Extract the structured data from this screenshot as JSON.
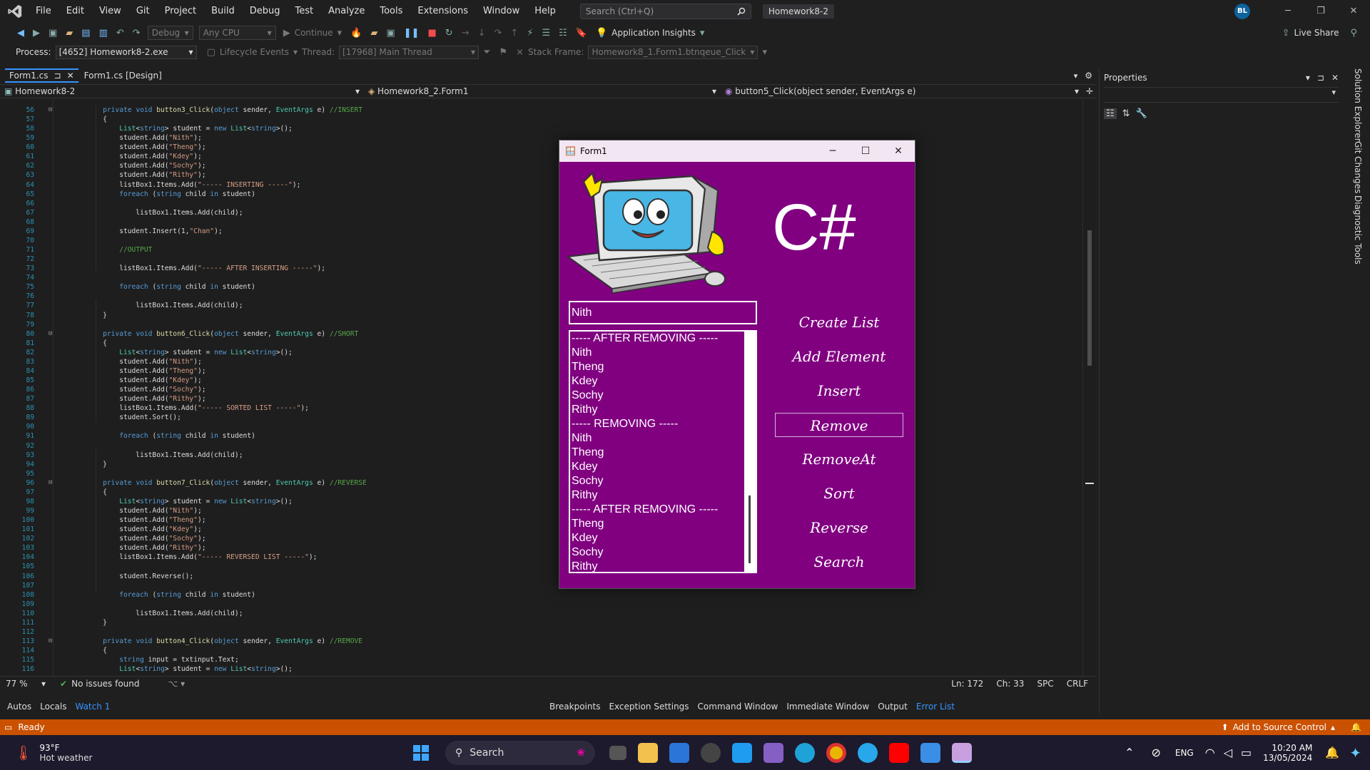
{
  "menubar": {
    "items": [
      "File",
      "Edit",
      "View",
      "Git",
      "Project",
      "Build",
      "Debug",
      "Test",
      "Analyze",
      "Tools",
      "Extensions",
      "Window",
      "Help"
    ],
    "search_placeholder": "Search (Ctrl+Q)",
    "solution_name": "Homework8-2",
    "avatar_initials": "BL"
  },
  "toolbar": {
    "config": "Debug",
    "platform": "Any CPU",
    "continue_label": "Continue",
    "app_insights": "Application Insights",
    "live_share": "Live Share"
  },
  "processbar": {
    "process_label": "Process:",
    "process_value": "[4652] Homework8-2.exe",
    "lifecycle_label": "Lifecycle Events",
    "thread_label": "Thread:",
    "thread_value": "[17968] Main Thread",
    "stackframe_label": "Stack Frame:",
    "stackframe_value": "Homework8_1.Form1.btnqeue_Click"
  },
  "tabs": [
    {
      "label": "Form1.cs",
      "pin": "⊐",
      "close": "✕"
    },
    {
      "label": "Form1.cs [Design]"
    }
  ],
  "navbar": {
    "project": "Homework8-2",
    "class": "Homework8_2.Form1",
    "member": "button5_Click(object sender, EventArgs e)"
  },
  "code_lines": [
    {
      "n": "56",
      "t": [
        [
          "    ",
          ""
        ],
        [
          "private void ",
          "kw"
        ],
        [
          "button3_Click",
          "fn"
        ],
        [
          "(",
          ""
        ],
        [
          "object ",
          "kw"
        ],
        [
          "sender, ",
          ""
        ],
        [
          "EventArgs ",
          "ty"
        ],
        [
          "e) ",
          ""
        ],
        [
          "//INSERT",
          "cm"
        ]
      ]
    },
    {
      "n": "57",
      "t": [
        [
          "    {",
          ""
        ]
      ]
    },
    {
      "n": "58",
      "t": [
        [
          "        ",
          ""
        ],
        [
          "List",
          "ty"
        ],
        [
          "<",
          ""
        ],
        [
          "string",
          "kw"
        ],
        [
          "> student = ",
          ""
        ],
        [
          "new ",
          "kw"
        ],
        [
          "List",
          "ty"
        ],
        [
          "<",
          ""
        ],
        [
          "string",
          "kw"
        ],
        [
          ">();",
          ""
        ]
      ]
    },
    {
      "n": "59",
      "t": [
        [
          "        student.Add(",
          ""
        ],
        [
          "\"Nith\"",
          "st"
        ],
        [
          ");",
          ""
        ]
      ]
    },
    {
      "n": "60",
      "t": [
        [
          "        student.Add(",
          ""
        ],
        [
          "\"Theng\"",
          "st"
        ],
        [
          ");",
          ""
        ]
      ]
    },
    {
      "n": "61",
      "t": [
        [
          "        student.Add(",
          ""
        ],
        [
          "\"Kdey\"",
          "st"
        ],
        [
          ");",
          ""
        ]
      ]
    },
    {
      "n": "62",
      "t": [
        [
          "        student.Add(",
          ""
        ],
        [
          "\"Sochy\"",
          "st"
        ],
        [
          ");",
          ""
        ]
      ]
    },
    {
      "n": "63",
      "t": [
        [
          "        student.Add(",
          ""
        ],
        [
          "\"Rithy\"",
          "st"
        ],
        [
          ");",
          ""
        ]
      ]
    },
    {
      "n": "64",
      "t": [
        [
          "        listBox1.Items.Add(",
          ""
        ],
        [
          "\"----- INSERTING -----\"",
          "st"
        ],
        [
          ");",
          ""
        ]
      ]
    },
    {
      "n": "65",
      "t": [
        [
          "        ",
          ""
        ],
        [
          "foreach ",
          "kw"
        ],
        [
          "(",
          ""
        ],
        [
          "string ",
          "kw"
        ],
        [
          "child ",
          ""
        ],
        [
          "in ",
          "kw"
        ],
        [
          "student)",
          ""
        ]
      ]
    },
    {
      "n": "66",
      "t": [
        [
          "",
          ""
        ]
      ]
    },
    {
      "n": "67",
      "t": [
        [
          "            listBox1.Items.Add(child);",
          ""
        ]
      ]
    },
    {
      "n": "68",
      "t": [
        [
          "",
          ""
        ]
      ]
    },
    {
      "n": "69",
      "t": [
        [
          "        student.Insert(1,",
          ""
        ],
        [
          "\"Chan\"",
          "st"
        ],
        [
          ");",
          ""
        ]
      ]
    },
    {
      "n": "70",
      "t": [
        [
          "",
          ""
        ]
      ]
    },
    {
      "n": "71",
      "t": [
        [
          "        ",
          ""
        ],
        [
          "//OUTPUT",
          "cm"
        ]
      ]
    },
    {
      "n": "72",
      "t": [
        [
          "",
          ""
        ]
      ]
    },
    {
      "n": "73",
      "t": [
        [
          "        listBox1.Items.Add(",
          ""
        ],
        [
          "\"----- AFTER INSERTING -----\"",
          "st"
        ],
        [
          ");",
          ""
        ]
      ]
    },
    {
      "n": "74",
      "t": [
        [
          "",
          ""
        ]
      ]
    },
    {
      "n": "75",
      "t": [
        [
          "        ",
          ""
        ],
        [
          "foreach ",
          "kw"
        ],
        [
          "(",
          ""
        ],
        [
          "string ",
          "kw"
        ],
        [
          "child ",
          ""
        ],
        [
          "in ",
          "kw"
        ],
        [
          "student)",
          ""
        ]
      ]
    },
    {
      "n": "76",
      "t": [
        [
          "",
          ""
        ]
      ]
    },
    {
      "n": "77",
      "t": [
        [
          "            listBox1.Items.Add(child);",
          ""
        ]
      ]
    },
    {
      "n": "78",
      "t": [
        [
          "    }",
          ""
        ]
      ]
    },
    {
      "n": "79",
      "t": [
        [
          "",
          ""
        ]
      ]
    },
    {
      "n": "80",
      "t": [
        [
          "    ",
          ""
        ],
        [
          "private void ",
          "kw"
        ],
        [
          "button6_Click",
          "fn"
        ],
        [
          "(",
          ""
        ],
        [
          "object ",
          "kw"
        ],
        [
          "sender, ",
          ""
        ],
        [
          "EventArgs ",
          "ty"
        ],
        [
          "e) ",
          ""
        ],
        [
          "//SHORT",
          "cm"
        ]
      ]
    },
    {
      "n": "81",
      "t": [
        [
          "    {",
          ""
        ]
      ]
    },
    {
      "n": "82",
      "t": [
        [
          "        ",
          ""
        ],
        [
          "List",
          "ty"
        ],
        [
          "<",
          ""
        ],
        [
          "string",
          "kw"
        ],
        [
          "> student = ",
          ""
        ],
        [
          "new ",
          "kw"
        ],
        [
          "List",
          "ty"
        ],
        [
          "<",
          ""
        ],
        [
          "string",
          "kw"
        ],
        [
          ">();",
          ""
        ]
      ]
    },
    {
      "n": "83",
      "t": [
        [
          "        student.Add(",
          ""
        ],
        [
          "\"Nith\"",
          "st"
        ],
        [
          ");",
          ""
        ]
      ]
    },
    {
      "n": "84",
      "t": [
        [
          "        student.Add(",
          ""
        ],
        [
          "\"Theng\"",
          "st"
        ],
        [
          ");",
          ""
        ]
      ]
    },
    {
      "n": "85",
      "t": [
        [
          "        student.Add(",
          ""
        ],
        [
          "\"Kdey\"",
          "st"
        ],
        [
          ");",
          ""
        ]
      ]
    },
    {
      "n": "86",
      "t": [
        [
          "        student.Add(",
          ""
        ],
        [
          "\"Sochy\"",
          "st"
        ],
        [
          ");",
          ""
        ]
      ]
    },
    {
      "n": "87",
      "t": [
        [
          "        student.Add(",
          ""
        ],
        [
          "\"Rithy\"",
          "st"
        ],
        [
          ");",
          ""
        ]
      ]
    },
    {
      "n": "88",
      "t": [
        [
          "        listBox1.Items.Add(",
          ""
        ],
        [
          "\"----- SORTED LIST -----\"",
          "st"
        ],
        [
          ");",
          ""
        ]
      ]
    },
    {
      "n": "89",
      "t": [
        [
          "        student.Sort();",
          ""
        ]
      ]
    },
    {
      "n": "90",
      "t": [
        [
          "",
          ""
        ]
      ]
    },
    {
      "n": "91",
      "t": [
        [
          "        ",
          ""
        ],
        [
          "foreach ",
          "kw"
        ],
        [
          "(",
          ""
        ],
        [
          "string ",
          "kw"
        ],
        [
          "child ",
          ""
        ],
        [
          "in ",
          "kw"
        ],
        [
          "student)",
          ""
        ]
      ]
    },
    {
      "n": "92",
      "t": [
        [
          "",
          ""
        ]
      ]
    },
    {
      "n": "93",
      "t": [
        [
          "            listBox1.Items.Add(child);",
          ""
        ]
      ]
    },
    {
      "n": "94",
      "t": [
        [
          "    }",
          ""
        ]
      ]
    },
    {
      "n": "95",
      "t": [
        [
          "",
          ""
        ]
      ]
    },
    {
      "n": "96",
      "t": [
        [
          "    ",
          ""
        ],
        [
          "private void ",
          "kw"
        ],
        [
          "button7_Click",
          "fn"
        ],
        [
          "(",
          ""
        ],
        [
          "object ",
          "kw"
        ],
        [
          "sender, ",
          ""
        ],
        [
          "EventArgs ",
          "ty"
        ],
        [
          "e) ",
          ""
        ],
        [
          "//REVERSE",
          "cm"
        ]
      ]
    },
    {
      "n": "97",
      "t": [
        [
          "    {",
          ""
        ]
      ]
    },
    {
      "n": "98",
      "t": [
        [
          "        ",
          ""
        ],
        [
          "List",
          "ty"
        ],
        [
          "<",
          ""
        ],
        [
          "string",
          "kw"
        ],
        [
          "> student = ",
          ""
        ],
        [
          "new ",
          "kw"
        ],
        [
          "List",
          "ty"
        ],
        [
          "<",
          ""
        ],
        [
          "string",
          "kw"
        ],
        [
          ">();",
          ""
        ]
      ]
    },
    {
      "n": "99",
      "t": [
        [
          "        student.Add(",
          ""
        ],
        [
          "\"Nith\"",
          "st"
        ],
        [
          ");",
          ""
        ]
      ]
    },
    {
      "n": "100",
      "t": [
        [
          "        student.Add(",
          ""
        ],
        [
          "\"Theng\"",
          "st"
        ],
        [
          ");",
          ""
        ]
      ]
    },
    {
      "n": "101",
      "t": [
        [
          "        student.Add(",
          ""
        ],
        [
          "\"Kdey\"",
          "st"
        ],
        [
          ");",
          ""
        ]
      ]
    },
    {
      "n": "102",
      "t": [
        [
          "        student.Add(",
          ""
        ],
        [
          "\"Sochy\"",
          "st"
        ],
        [
          ");",
          ""
        ]
      ]
    },
    {
      "n": "103",
      "t": [
        [
          "        student.Add(",
          ""
        ],
        [
          "\"Rithy\"",
          "st"
        ],
        [
          ");",
          ""
        ]
      ]
    },
    {
      "n": "104",
      "t": [
        [
          "        listBox1.Items.Add(",
          ""
        ],
        [
          "\"----- REVERSED LIST -----\"",
          "st"
        ],
        [
          ");",
          ""
        ]
      ]
    },
    {
      "n": "105",
      "t": [
        [
          "",
          ""
        ]
      ]
    },
    {
      "n": "106",
      "t": [
        [
          "        student.Reverse();",
          ""
        ]
      ]
    },
    {
      "n": "107",
      "t": [
        [
          "",
          ""
        ]
      ]
    },
    {
      "n": "108",
      "t": [
        [
          "        ",
          ""
        ],
        [
          "foreach ",
          "kw"
        ],
        [
          "(",
          ""
        ],
        [
          "string ",
          "kw"
        ],
        [
          "child ",
          ""
        ],
        [
          "in ",
          "kw"
        ],
        [
          "student)",
          ""
        ]
      ]
    },
    {
      "n": "109",
      "t": [
        [
          "",
          ""
        ]
      ]
    },
    {
      "n": "110",
      "t": [
        [
          "            listBox1.Items.Add(child);",
          ""
        ]
      ]
    },
    {
      "n": "111",
      "t": [
        [
          "    }",
          ""
        ]
      ]
    },
    {
      "n": "112",
      "t": [
        [
          "",
          ""
        ]
      ]
    },
    {
      "n": "113",
      "t": [
        [
          "    ",
          ""
        ],
        [
          "private void ",
          "kw"
        ],
        [
          "button4_Click",
          "fn"
        ],
        [
          "(",
          ""
        ],
        [
          "object ",
          "kw"
        ],
        [
          "sender, ",
          ""
        ],
        [
          "EventArgs ",
          "ty"
        ],
        [
          "e) ",
          ""
        ],
        [
          "//REMOVE",
          "cm"
        ]
      ]
    },
    {
      "n": "114",
      "t": [
        [
          "    {",
          ""
        ]
      ]
    },
    {
      "n": "115",
      "t": [
        [
          "        ",
          ""
        ],
        [
          "string ",
          "kw"
        ],
        [
          "input = txtinput.Text;",
          ""
        ]
      ]
    },
    {
      "n": "116",
      "t": [
        [
          "        ",
          ""
        ],
        [
          "List",
          "ty"
        ],
        [
          "<",
          ""
        ],
        [
          "string",
          "kw"
        ],
        [
          "> student = ",
          ""
        ],
        [
          "new ",
          "kw"
        ],
        [
          "List",
          "ty"
        ],
        [
          "<",
          ""
        ],
        [
          "string",
          "kw"
        ],
        [
          ">();",
          ""
        ]
      ]
    }
  ],
  "properties": {
    "title": "Properties"
  },
  "vertical_tabs": [
    "Solution Explorer",
    "Git Changes",
    "Diagnostic Tools"
  ],
  "editor_status": {
    "zoom": "77 %",
    "issues": "No issues found",
    "ln": "Ln: 172",
    "ch": "Ch: 33",
    "spc": "SPC",
    "crlf": "CRLF"
  },
  "bottom_left_tabs": [
    "Autos",
    "Locals",
    "Watch 1"
  ],
  "bottom_right_tabs": [
    "Breakpoints",
    "Exception Settings",
    "Command Window",
    "Immediate Window",
    "Output",
    "Error List"
  ],
  "statusbar": {
    "ready": "Ready",
    "source_control": "Add to Source Control"
  },
  "taskbar": {
    "weather_temp": "93°F",
    "weather_desc": "Hot weather",
    "search_label": "Search",
    "lang": "ENG",
    "time": "10:20 AM",
    "date": "13/05/2024"
  },
  "form1": {
    "title": "Form1",
    "logo_text": "C#",
    "input_value": "Nith",
    "list_items": [
      "----- AFTER REMOVING -----",
      "Nith",
      "Theng",
      "Kdey",
      "Sochy",
      "Rithy",
      "----- REMOVING -----",
      "Nith",
      "Theng",
      "Kdey",
      "Sochy",
      "Rithy",
      "----- AFTER REMOVING -----",
      "Theng",
      "Kdey",
      "Sochy",
      "Rithy"
    ],
    "buttons": [
      "Create List",
      "Add Element",
      "Insert",
      "Remove",
      "RemoveAt",
      "Sort",
      "Reverse",
      "Search"
    ],
    "focused_button": "Remove"
  },
  "colors": {
    "form_background": "#800080",
    "status_bar": "#ca5100",
    "accent": "#3794ff"
  }
}
